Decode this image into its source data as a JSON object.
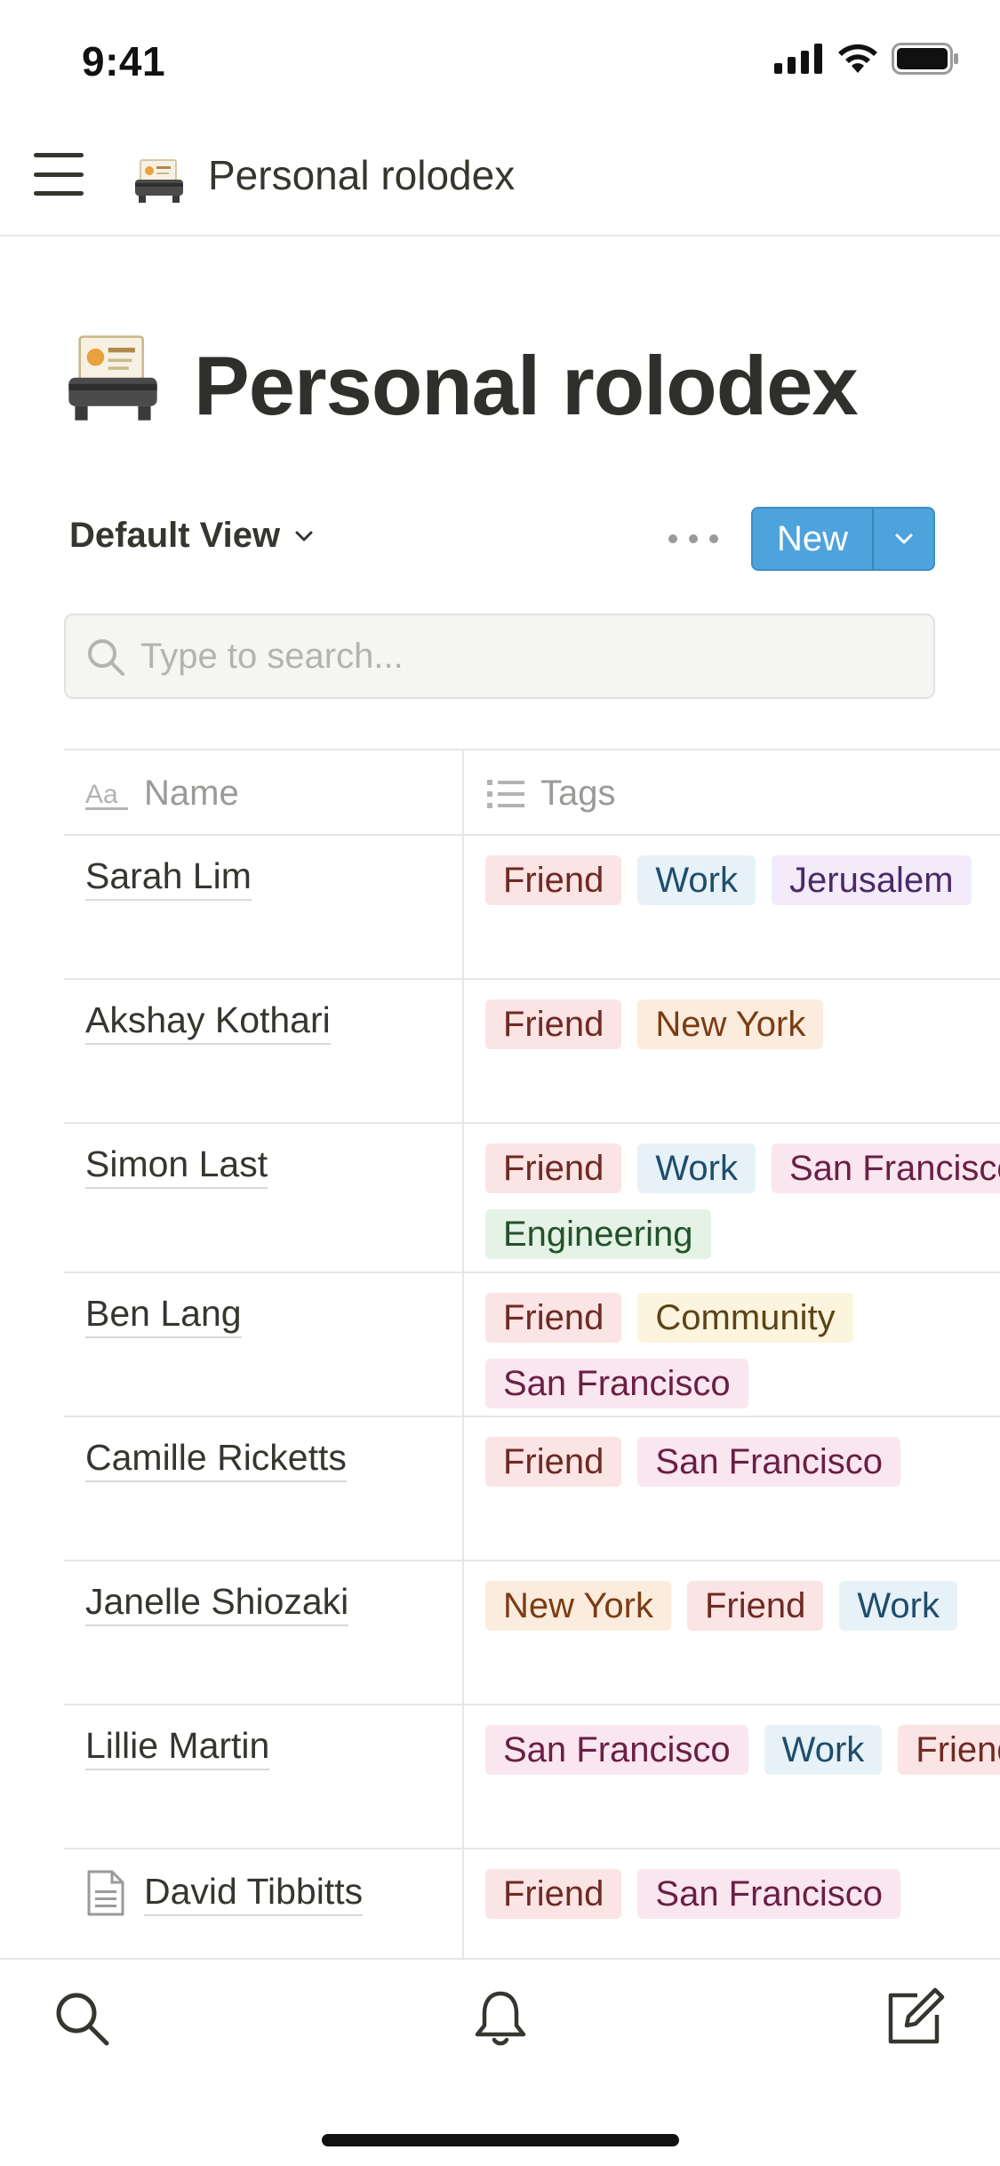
{
  "status_bar": {
    "time": "9:41"
  },
  "top_nav": {
    "title": "Personal rolodex",
    "icon": "rolodex-emoji"
  },
  "page": {
    "title": "Personal rolodex",
    "icon": "rolodex-emoji"
  },
  "view_bar": {
    "view_label": "Default View",
    "new_label": "New"
  },
  "search": {
    "placeholder": "Type to search...",
    "value": ""
  },
  "table": {
    "columns": [
      {
        "label": "Name",
        "icon": "text-property-icon"
      },
      {
        "label": "Tags",
        "icon": "multi-select-icon"
      }
    ],
    "rows": [
      {
        "name": "Sarah Lim",
        "tags": [
          "Friend",
          "Work",
          "Jerusalem"
        ]
      },
      {
        "name": "Akshay Kothari",
        "tags": [
          "Friend",
          "New York"
        ]
      },
      {
        "name": "Simon Last",
        "tags": [
          "Friend",
          "Work",
          "San Francisco",
          "Engineering"
        ]
      },
      {
        "name": "Ben Lang",
        "tags": [
          "Friend",
          "Community",
          "San Francisco"
        ]
      },
      {
        "name": "Camille Ricketts",
        "tags": [
          "Friend",
          "San Francisco"
        ]
      },
      {
        "name": "Janelle Shiozaki",
        "tags": [
          "New York",
          "Friend",
          "Work"
        ]
      },
      {
        "name": "Lillie Martin",
        "tags": [
          "San Francisco",
          "Work",
          "Friend"
        ]
      },
      {
        "name": "David Tibbitts",
        "tags": [
          "Friend",
          "San Francisco"
        ],
        "page_icon": "page-icon"
      }
    ]
  },
  "tag_colors": {
    "Friend": {
      "bg": "#fbe4e4",
      "fg": "#6f2a24"
    },
    "Work": {
      "bg": "#e7f1f8",
      "fg": "#1f4d6d"
    },
    "Jerusalem": {
      "bg": "#f3eafa",
      "fg": "#4a2a66"
    },
    "New York": {
      "bg": "#fbecdd",
      "fg": "#7a3d14"
    },
    "San Francisco": {
      "bg": "#f9e6ef",
      "fg": "#6a1f44"
    },
    "Engineering": {
      "bg": "#e5f2e6",
      "fg": "#23522a"
    },
    "Community": {
      "bg": "#fdf4de",
      "fg": "#5c4416"
    }
  },
  "bottom_nav": {
    "items": [
      {
        "icon": "search-icon"
      },
      {
        "icon": "bell-icon"
      },
      {
        "icon": "compose-icon"
      }
    ]
  },
  "colors": {
    "accent": "#4da3dc",
    "text": "#37352f",
    "muted": "#9b9a97",
    "divider": "#e6e6e4"
  }
}
